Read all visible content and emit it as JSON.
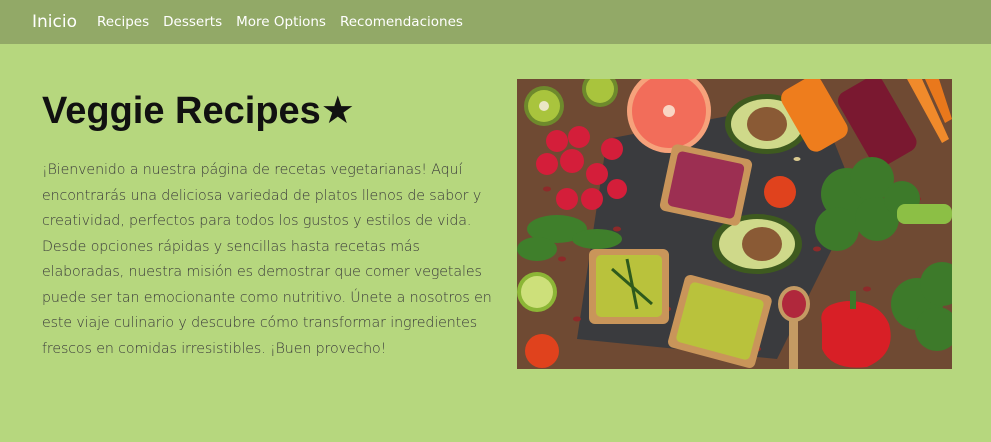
{
  "navbar": {
    "brand": "Inicio",
    "links": [
      "Recipes",
      "Desserts",
      "More Options",
      "Recomendaciones"
    ]
  },
  "hero": {
    "title": "Veggie Recipes★",
    "text": "¡Bienvenido a nuestra página de recetas vegetarianas! Aquí encontrarás una deliciosa variedad de platos llenos de sabor y creatividad, perfectos para todos los gustos y estilos de vida. Desde opciones rápidas y sencillas hasta recetas más elaboradas, nuestra misión es demostrar que comer vegetales puede ser tan emocionante como nutritivo. Únete a nosotros en este viaje culinario y descubre cómo transformar ingredientes frescos en comidas irresistibles. ¡Buen provecho!"
  },
  "colors": {
    "page_background": "#b6d77e",
    "navbar_background": "#92a967",
    "navbar_text": "#ffffff"
  }
}
